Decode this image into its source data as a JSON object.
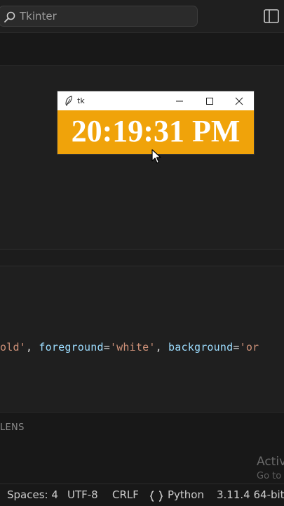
{
  "search": {
    "query": "Tkinter"
  },
  "editor": {
    "code_tokens": [
      {
        "text": "old'",
        "kind": "str"
      },
      {
        "text": ", ",
        "kind": "op"
      },
      {
        "text": "foreground",
        "kind": "attr"
      },
      {
        "text": "=",
        "kind": "op"
      },
      {
        "text": "'white'",
        "kind": "str"
      },
      {
        "text": ", ",
        "kind": "op"
      },
      {
        "text": "background",
        "kind": "attr"
      },
      {
        "text": "=",
        "kind": "op"
      },
      {
        "text": "'or",
        "kind": "str"
      }
    ]
  },
  "panel": {
    "header": "LENS",
    "activate_title": "Activ",
    "activate_sub": "Go to"
  },
  "statusbar": {
    "spaces": "Spaces: 4",
    "encoding": "UTF-8",
    "eol": "CRLF",
    "language": "Python",
    "interpreter": "3.11.4 64-bit"
  },
  "tk": {
    "title": "tk",
    "clock": "20:19:31 PM",
    "bg_color": "#f0a30a",
    "fg_color": "#ffffff"
  },
  "colors": {
    "string": "#ce9178",
    "attribute": "#9cdcfe",
    "operator": "#d4d4d4"
  }
}
